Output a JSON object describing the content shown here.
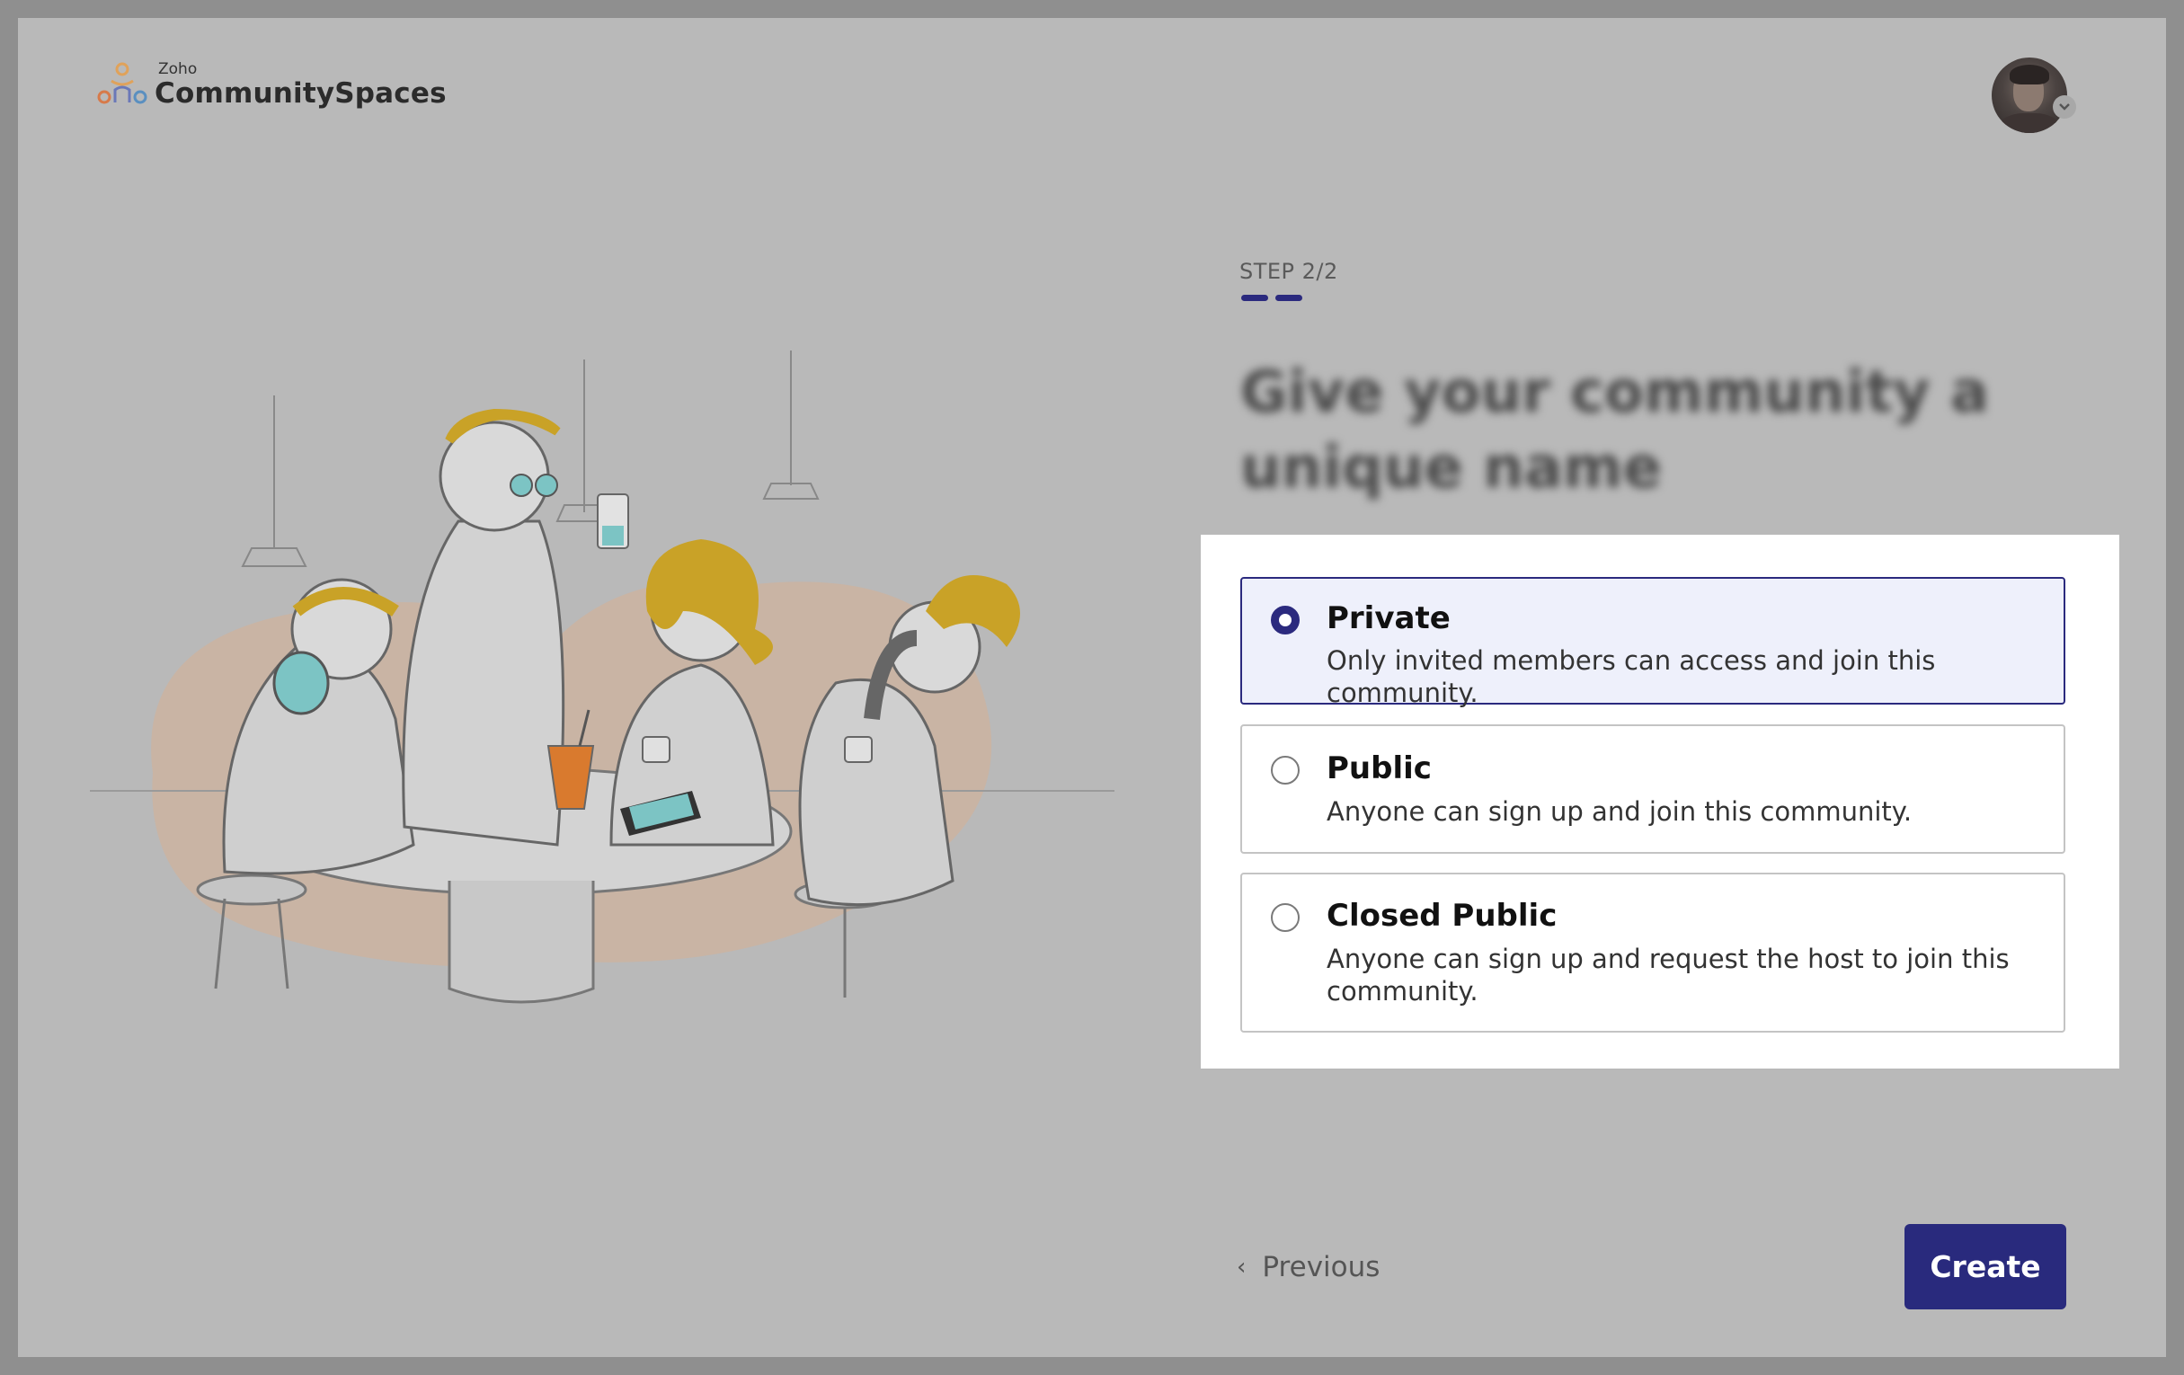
{
  "brand": {
    "zoho_label": "Zoho",
    "product_name": "CommunitySpaces"
  },
  "user_menu": {
    "avatar": "user-avatar",
    "chevron_icon": "chevron-down-icon"
  },
  "wizard": {
    "step_label": "STEP 2/2",
    "step_count": 2,
    "current_step": 2,
    "heading": "Give your community a unique name",
    "accent_color": "#2b2a7e",
    "options": [
      {
        "title": "Private",
        "description": "Only invited members can access and join this community.",
        "selected": true
      },
      {
        "title": "Public",
        "description": "Anyone can sign up and join this community.",
        "selected": false
      },
      {
        "title": "Closed Public",
        "description": "Anyone can sign up and request the host to join this community.",
        "selected": false
      }
    ],
    "previous_label": "Previous",
    "create_label": "Create"
  }
}
